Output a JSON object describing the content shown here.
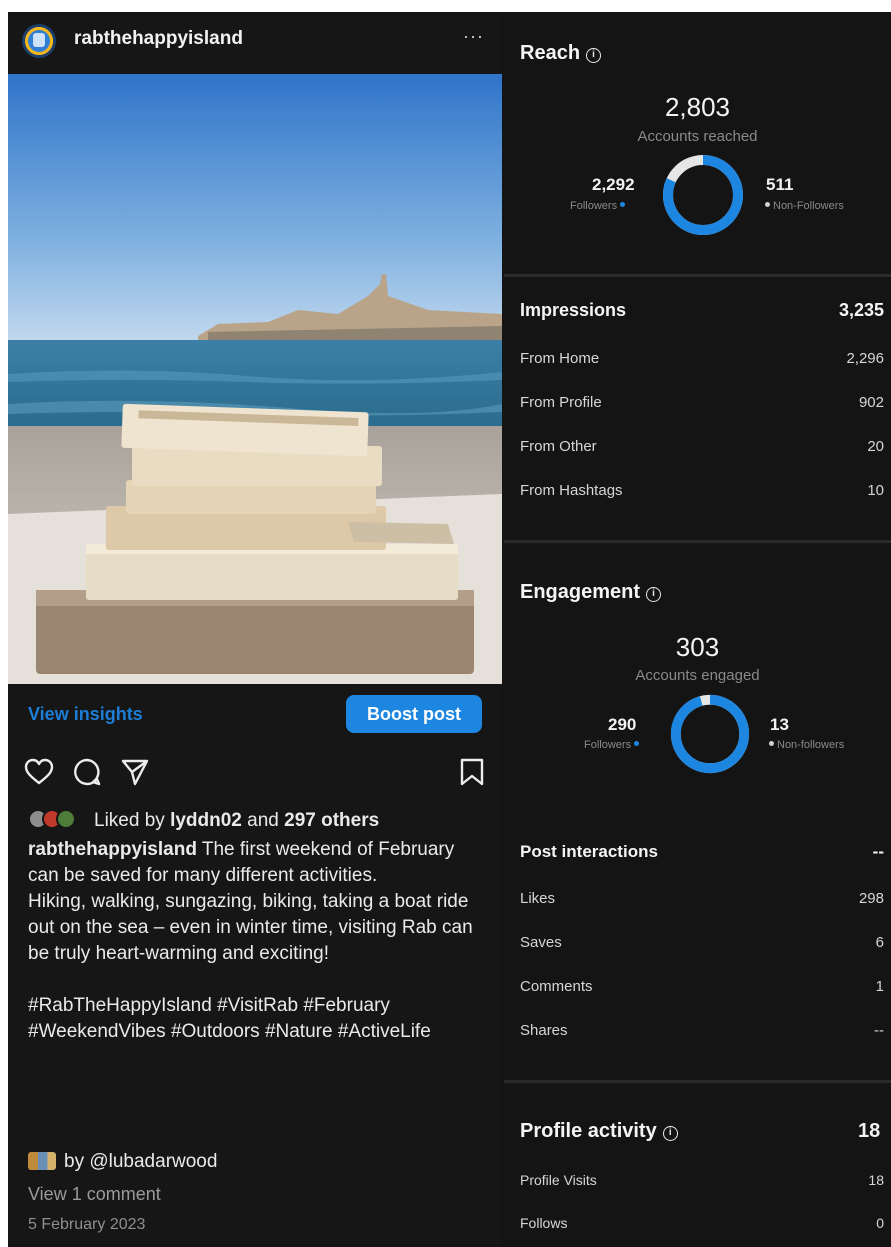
{
  "post": {
    "username": "rabthehappyisland",
    "more_label": "···",
    "view_insights_label": "View insights",
    "boost_label": "Boost post",
    "likes": {
      "prefix": "Liked by",
      "liker": "lyddn02",
      "joiner": "and",
      "others": "297 others"
    },
    "caption": {
      "author": "rabthehappyisland",
      "text_1": "The first weekend of February can be saved for many different activities.",
      "text_2": "Hiking, walking, sungazing, biking, taking a boat ride out on the sea – even in winter time, visiting Rab can be truly heart-warming and exciting!",
      "hashtags": "#RabTheHappyIsland #VisitRab #February #WeekendVibes #Outdoors #Nature #ActiveLife"
    },
    "credit": "by @lubadarwood",
    "view_comments": "View 1 comment",
    "date": "5 February 2023"
  },
  "insights": {
    "reach": {
      "title": "Reach",
      "total": "2,803",
      "total_label": "Accounts reached",
      "followers_value": "2,292",
      "followers_label": "Followers",
      "non_followers_value": "511",
      "non_followers_label": "Non-Followers",
      "followers_share": 0.818
    },
    "impressions": {
      "title": "Impressions",
      "total": "3,235",
      "rows": [
        {
          "label": "From Home",
          "value": "2,296"
        },
        {
          "label": "From Profile",
          "value": "902"
        },
        {
          "label": "From Other",
          "value": "20"
        },
        {
          "label": "From Hashtags",
          "value": "10"
        }
      ]
    },
    "engagement": {
      "title": "Engagement",
      "total": "303",
      "total_label": "Accounts engaged",
      "followers_value": "290",
      "followers_label": "Followers",
      "non_followers_value": "13",
      "non_followers_label": "Non-followers",
      "followers_share": 0.957
    },
    "interactions": {
      "title": "Post interactions",
      "total": "--",
      "rows": [
        {
          "label": "Likes",
          "value": "298"
        },
        {
          "label": "Saves",
          "value": "6"
        },
        {
          "label": "Comments",
          "value": "1"
        },
        {
          "label": "Shares",
          "value": "--"
        }
      ]
    },
    "profile_activity": {
      "title": "Profile activity",
      "total": "18",
      "rows": [
        {
          "label": "Profile Visits",
          "value": "18"
        },
        {
          "label": "Follows",
          "value": "0"
        }
      ]
    }
  },
  "colors": {
    "accent": "#1c86e0",
    "background": "#141414",
    "donut_remainder": "#e6e6e6"
  }
}
